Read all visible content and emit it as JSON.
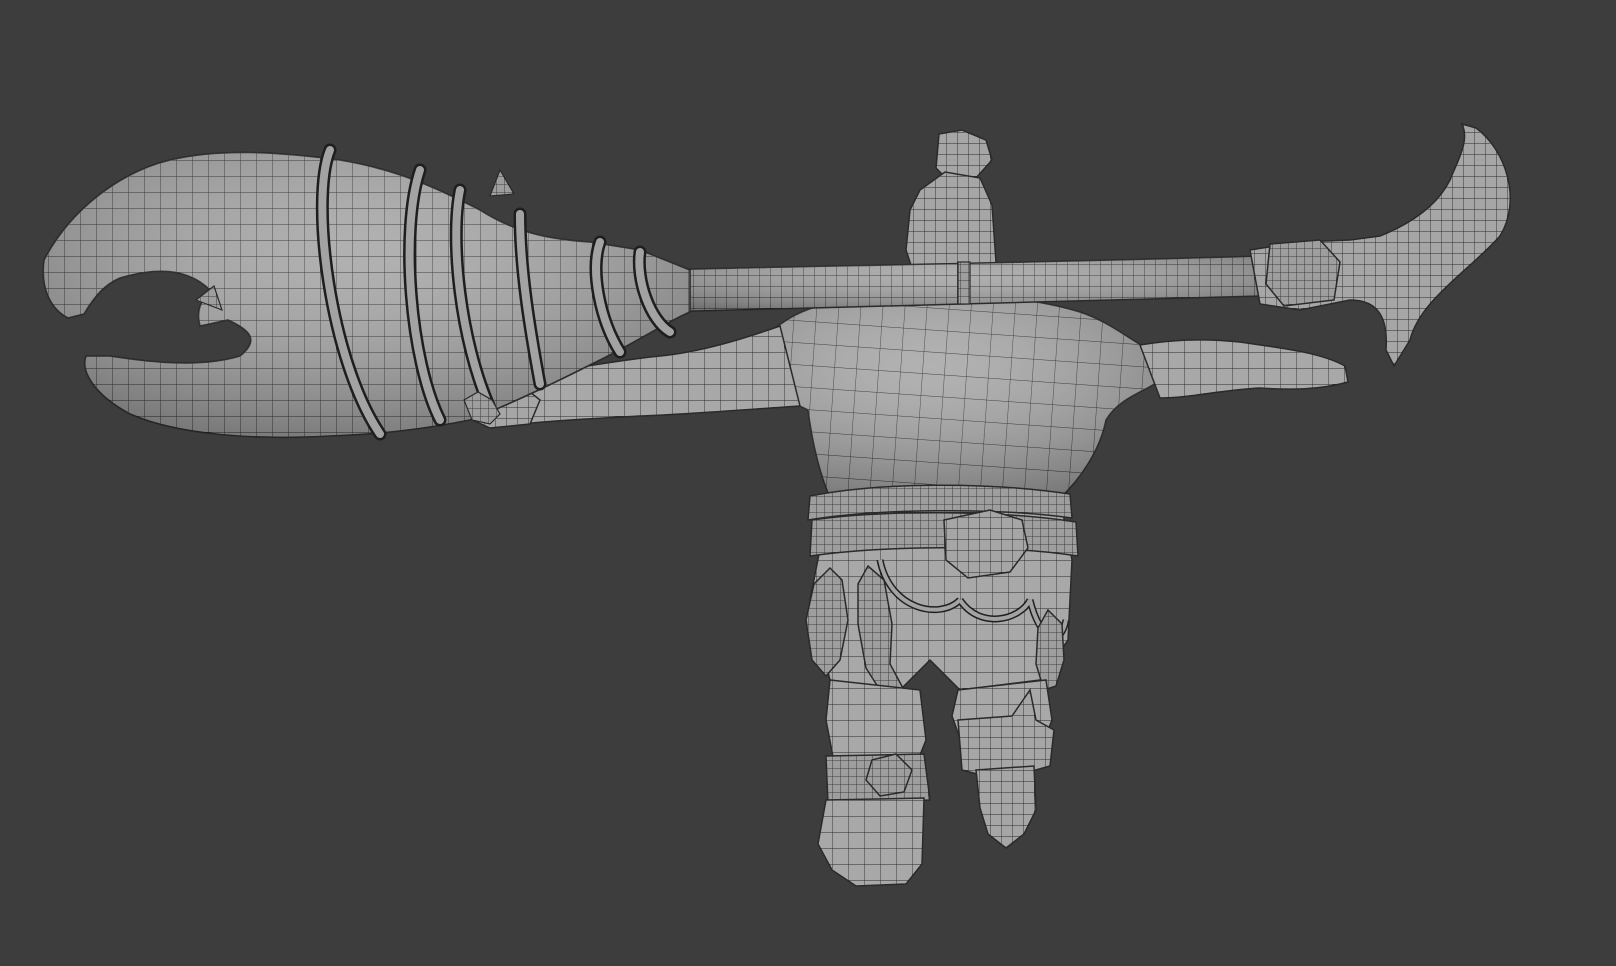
{
  "viewport": {
    "background_color": "#3d3d3d",
    "mesh_fill_color": "#a4a4a4",
    "mesh_shadow_color": "#7a7a7a",
    "wire_color": "#262626",
    "shading_mode": "solid-wireframe"
  },
  "scene": {
    "objects": [
      "claw-staff",
      "character-body",
      "belt",
      "hanging-fish",
      "left-leg",
      "peg-leg"
    ]
  }
}
